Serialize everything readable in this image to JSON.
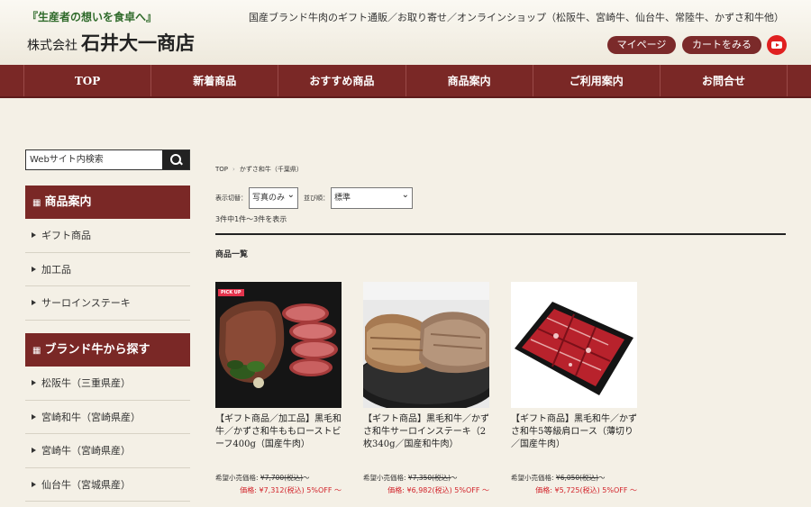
{
  "header": {
    "tagline": "『生産者の想いを食卓へ』",
    "company_prefix": "株式会社",
    "company_name": "石井大一商店",
    "description": "国産ブランド牛肉のギフト通販／お取り寄せ／オンラインショップ（松阪牛、宮崎牛、仙台牛、常陸牛、かずさ和牛他）",
    "mypage_label": "マイページ",
    "cart_label": "カートをみる"
  },
  "nav": [
    "TOP",
    "新着商品",
    "おすすめ商品",
    "商品案内",
    "ご利用案内",
    "お問合せ"
  ],
  "search": {
    "placeholder": "Webサイト内検索"
  },
  "sidebar": {
    "products_heading": "商品案内",
    "products": [
      "ギフト商品",
      "加工品",
      "サーロインステーキ"
    ],
    "brands_heading": "ブランド牛から探す",
    "brands": [
      "松阪牛（三重県産）",
      "宮崎和牛（宮崎県産）",
      "宮崎牛（宮崎県産）",
      "仙台牛（宮城県産）"
    ]
  },
  "breadcrumb": {
    "home": "TOP",
    "current": "かずさ和牛（千葉県）"
  },
  "filters": {
    "view_label": "表示切替：",
    "view_value": "写真のみ",
    "sort_label": "並び順：",
    "sort_value": "標準"
  },
  "result_count": "3件中1件〜3件を表示",
  "list_title": "商品一覧",
  "products": [
    {
      "name": "【ギフト商品／加工品】黒毛和牛／かずさ和牛ももローストビーフ400g（国産牛肉）",
      "list_price_label": "希望小売価格:",
      "list_price": "¥7,700(税込)",
      "list_price_suffix": "〜",
      "sale_price": "価格: ¥7,312(税込) 5%OFF 〜",
      "badge": "PICK UP"
    },
    {
      "name": "【ギフト商品】黒毛和牛／かずさ和牛サーロインステーキ（2枚340g／国産和牛肉）",
      "list_price_label": "希望小売価格:",
      "list_price": "¥7,350(税込)",
      "list_price_suffix": "〜",
      "sale_price": "価格: ¥6,982(税込) 5%OFF 〜"
    },
    {
      "name": "【ギフト商品】黒毛和牛／かずさ和牛5等級肩ロース（薄切り／国産牛肉）",
      "list_price_label": "希望小売価格:",
      "list_price": "¥6,050(税込)",
      "list_price_suffix": "〜",
      "sale_price": "価格: ¥5,725(税込) 5%OFF 〜"
    }
  ],
  "colors": {
    "brand": "#7a2826",
    "sale": "#d2232a",
    "background": "#f4f0e6"
  }
}
